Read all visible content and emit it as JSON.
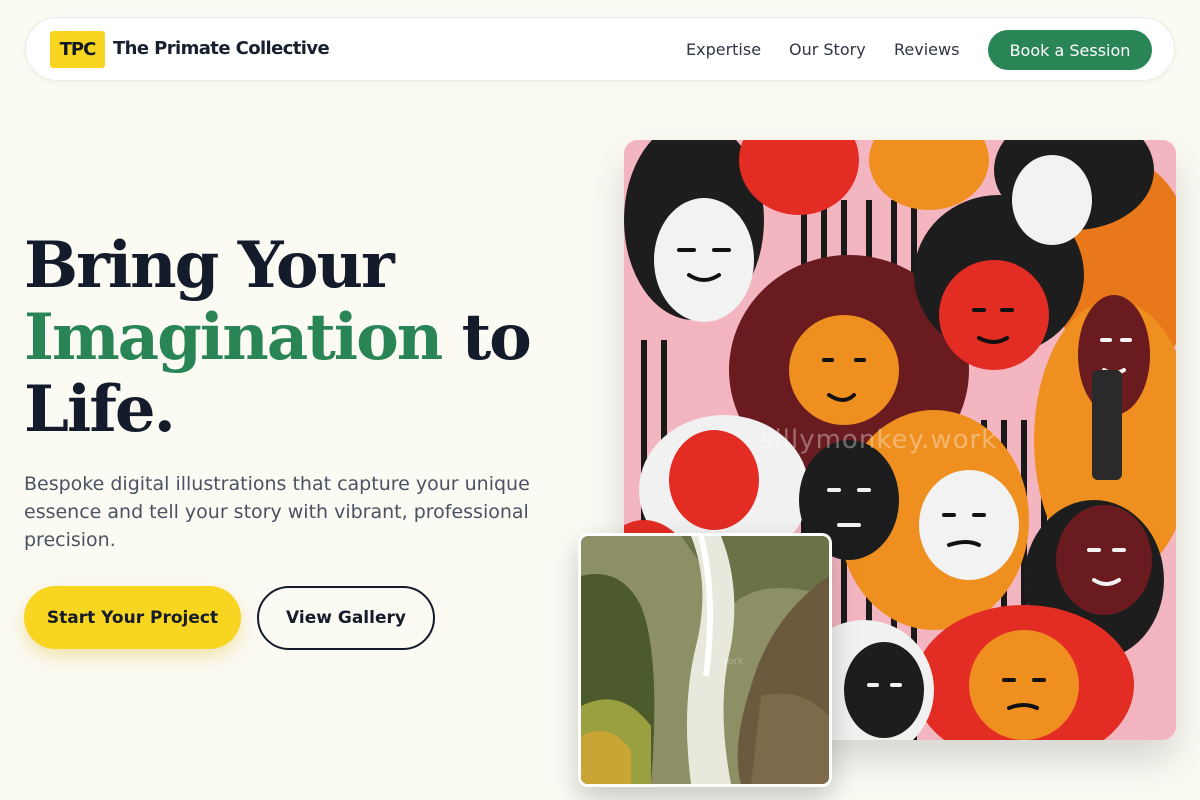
{
  "brand": {
    "badge": "TPC",
    "name": "The Primate Collective"
  },
  "nav": {
    "links": [
      "Expertise",
      "Our Story",
      "Reviews"
    ],
    "cta": "Book a Session"
  },
  "hero": {
    "title_line1": "Bring Your",
    "title_accent": "Imagination",
    "title_line2_rest": " to",
    "title_line3": "Life.",
    "subtitle": "Bespoke digital illustrations that capture your unique essence and tell your story with vibrant, professional precision.",
    "primary_button": "Start Your Project",
    "secondary_button": "View Gallery"
  },
  "images": {
    "watermark": "sillymonkey.work"
  },
  "colors": {
    "background": "#fbfaf3",
    "accent_green": "#2a8556",
    "accent_yellow": "#f8d520",
    "text_dark": "#141b2b"
  }
}
